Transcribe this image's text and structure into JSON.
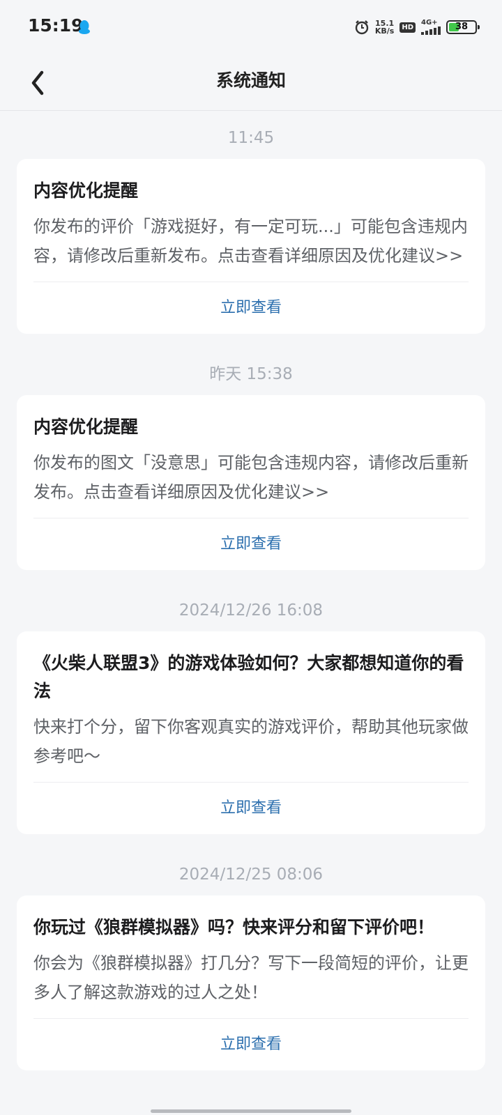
{
  "status_bar": {
    "time": "15:19",
    "network_speed": "15.1",
    "network_unit": "KB/s",
    "hd": "HD",
    "signal": "4G+",
    "battery": "38",
    "battery_fraction": 0.38,
    "icons": [
      "qq-icon",
      "alarm-icon",
      "signal-icon"
    ]
  },
  "nav": {
    "title": "系统通知",
    "back_icon": "chevron-left-icon"
  },
  "notifications": [
    {
      "time": "11:45",
      "title": "内容优化提醒",
      "body": "你发布的评价「游戏挺好，有一定可玩...」可能包含违规内容，请修改后重新发布。点击查看详细原因及优化建议>>",
      "action": "立即查看"
    },
    {
      "time": "昨天  15:38",
      "title": "内容优化提醒",
      "body": "你发布的图文「没意思」可能包含违规内容，请修改后重新发布。点击查看详细原因及优化建议>>",
      "action": "立即查看"
    },
    {
      "time": "2024/12/26  16:08",
      "title": "《火柴人联盟3》的游戏体验如何？大家都想知道你的看法",
      "body": "快来打个分，留下你客观真实的游戏评价，帮助其他玩家做参考吧～",
      "action": "立即查看"
    },
    {
      "time": "2024/12/25  08:06",
      "title": "你玩过《狼群模拟器》吗？快来评分和留下评价吧！",
      "body": "你会为《狼群模拟器》打几分？写下一段简短的评价，让更多人了解这款游戏的过人之处！",
      "action": "立即查看"
    }
  ],
  "colors": {
    "background": "#f5f6f8",
    "action": "#2c6fae",
    "timestamp": "#a8adb5",
    "battery": "#41c84a",
    "qq": "#1aa7f0"
  }
}
